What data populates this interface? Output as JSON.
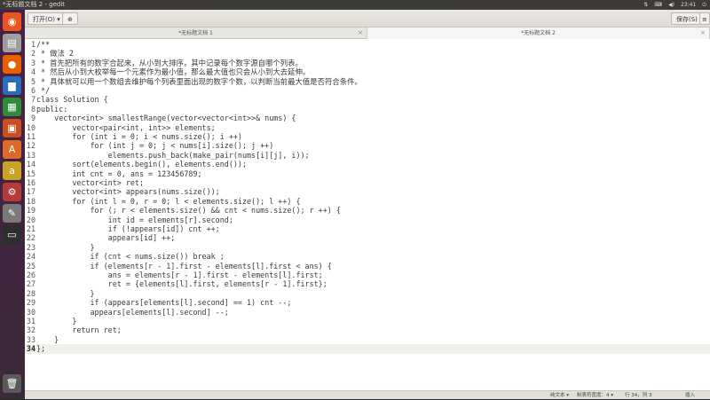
{
  "system": {
    "window_title": "*无标题文档 2 - gedit",
    "clock": "23:41",
    "icons": [
      "network-icon",
      "keyboard-icon",
      "volume-icon",
      "power-icon"
    ]
  },
  "launcher": {
    "items": [
      {
        "name": "ubuntu-dash-icon",
        "glyph": "◉",
        "color": "#e95420"
      },
      {
        "name": "files-icon",
        "glyph": "▤",
        "color": "#9e9e9e"
      },
      {
        "name": "firefox-icon",
        "glyph": "●",
        "color": "#e66000"
      },
      {
        "name": "writer-icon",
        "glyph": "▆",
        "color": "#2a6ebb"
      },
      {
        "name": "calc-icon",
        "glyph": "▦",
        "color": "#2f8a3a"
      },
      {
        "name": "impress-icon",
        "glyph": "▣",
        "color": "#c8501e"
      },
      {
        "name": "software-center-icon",
        "glyph": "A",
        "color": "#dd6a2a"
      },
      {
        "name": "amazon-icon",
        "glyph": "a",
        "color": "#c9a227"
      },
      {
        "name": "settings-icon",
        "glyph": "⚙",
        "color": "#b53a3a"
      },
      {
        "name": "text-editor-icon",
        "glyph": "✎",
        "color": "#7a7a7a"
      },
      {
        "name": "terminal-icon",
        "glyph": "▭",
        "color": "#2e2e2e"
      },
      {
        "name": "trash-icon",
        "glyph": "🗑",
        "color": "#5a5a5a"
      }
    ]
  },
  "toolbar": {
    "open_label": "打开(O) ▾",
    "new_tab_icon": "⊕",
    "save_label": "保存(S)",
    "menu_icon": "≡"
  },
  "tabs": [
    {
      "label": "*无标题文档 1",
      "active": false
    },
    {
      "label": "*无标题文档 2",
      "active": true
    }
  ],
  "editor": {
    "current_line": 34,
    "lines": [
      "/**",
      " * 做法 2",
      " * 首先把所有的数字合起来，从小到大排序，其中记录每个数字源自哪个列表。",
      " * 然后从小到大枚举每一个元素作为最小值，那么最大值也只会从小到大去延伸。",
      " * 具体就可以用一个数组去维护每个列表里面出现的数字个数，以判断当前最大值是否符合条件。",
      " */",
      "class Solution {",
      "public:",
      "    vector<int> smallestRange(vector<vector<int>>& nums) {",
      "        vector<pair<int, int>> elements;",
      "        for (int i = 0; i < nums.size(); i ++)",
      "            for (int j = 0; j < nums[i].size(); j ++)",
      "                elements.push_back(make_pair(nums[i][j], i));",
      "        sort(elements.begin(), elements.end());",
      "        int cnt = 0, ans = 123456789;",
      "        vector<int> ret;",
      "        vector<int> appears(nums.size());",
      "        for (int l = 0, r = 0; l < elements.size(); l ++) {",
      "            for (; r < elements.size() && cnt < nums.size(); r ++) {",
      "                int id = elements[r].second;",
      "                if (!appears[id]) cnt ++;",
      "                appears[id] ++;",
      "            }",
      "            if (cnt < nums.size()) break ;",
      "            if (elements[r - 1].first - elements[l].first < ans) {",
      "                ans = elements[r - 1].first - elements[l].first;",
      "                ret = {elements[l].first, elements[r - 1].first};",
      "            }",
      "            if (appears[elements[l].second] == 1) cnt --;",
      "            appears[elements[l].second] --;",
      "        }",
      "        return ret;",
      "    }",
      "};"
    ]
  },
  "statusbar": {
    "language": "纯文本 ▾",
    "tab_width": "制表符宽度：4 ▾",
    "position": "行 34，列 3",
    "mode": "插入"
  }
}
